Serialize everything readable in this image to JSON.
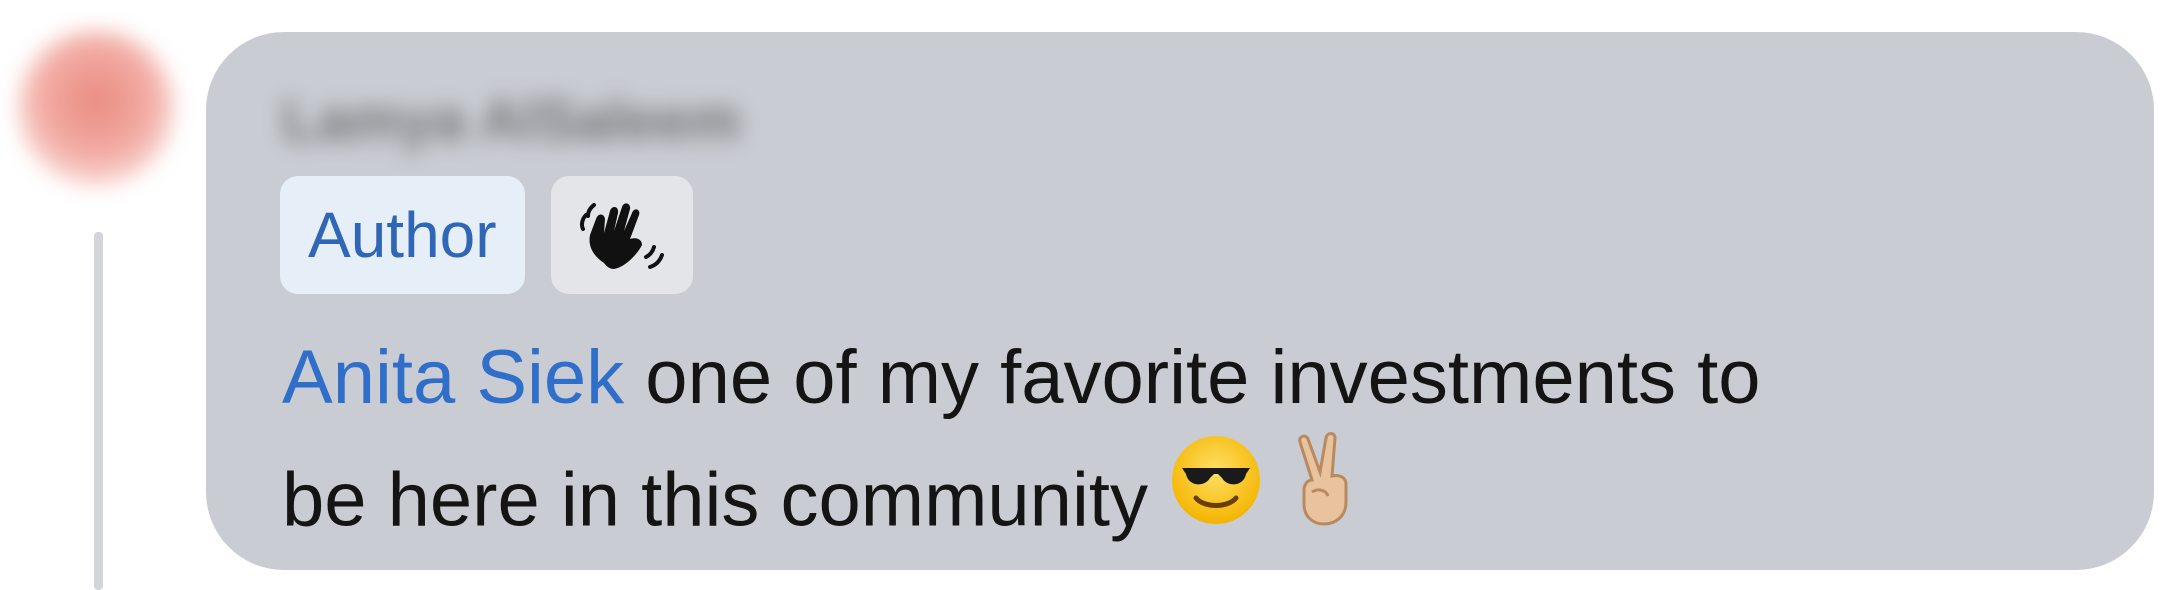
{
  "comment": {
    "author_name": "Lamya AlSaleem",
    "badges": {
      "author_label": "Author",
      "wave_icon": "waving-hand-icon"
    },
    "mention": "Anita Siek",
    "text_line1_rest": " one of my favorite investments to",
    "text_line2": "be here in this community",
    "emojis": [
      "smiling-face-with-sunglasses-icon",
      "victory-hand-icon"
    ]
  },
  "colors": {
    "bubble": "#c9ccd2",
    "author_badge_bg": "#e6eef8",
    "author_badge_text": "#2f66b6",
    "mention": "#2f6ec9",
    "thread_line": "#d3d5da"
  }
}
